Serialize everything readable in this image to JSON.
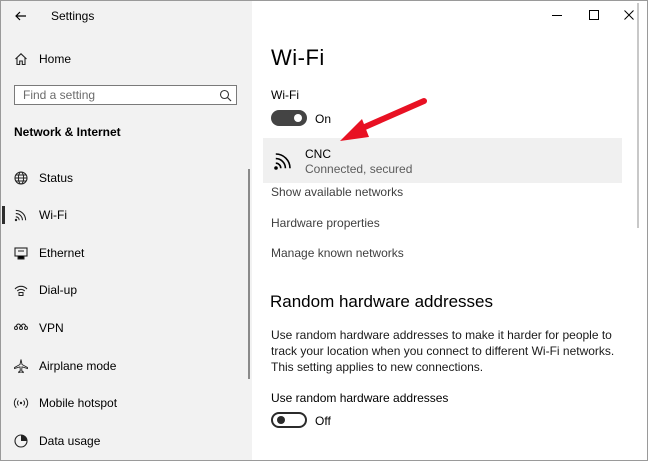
{
  "window": {
    "title": "Settings",
    "controls": [
      "minimize-icon",
      "maximize-icon",
      "close-icon"
    ]
  },
  "sidebar": {
    "home_label": "Home",
    "search_placeholder": "Find a setting",
    "section_title": "Network & Internet",
    "selected": "Wi-Fi",
    "items": [
      {
        "label": "Status",
        "icon": "globe-icon"
      },
      {
        "label": "Wi-Fi",
        "icon": "wifi-icon"
      },
      {
        "label": "Ethernet",
        "icon": "ethernet-icon"
      },
      {
        "label": "Dial-up",
        "icon": "dialup-icon"
      },
      {
        "label": "VPN",
        "icon": "vpn-icon"
      },
      {
        "label": "Airplane mode",
        "icon": "airplane-icon"
      },
      {
        "label": "Mobile hotspot",
        "icon": "hotspot-icon"
      },
      {
        "label": "Data usage",
        "icon": "data-usage-icon"
      }
    ]
  },
  "main": {
    "title": "Wi-Fi",
    "wifi_toggle": {
      "label": "Wi-Fi",
      "state": "On"
    },
    "network": {
      "name": "CNC",
      "status": "Connected, secured"
    },
    "links": [
      "Show available networks",
      "Hardware properties",
      "Manage known networks"
    ],
    "random_hw": {
      "heading": "Random hardware addresses",
      "description": "Use random hardware addresses to make it harder for people to track your location when you connect to different Wi-Fi networks. This setting applies to new connections.",
      "toggle_label": "Use random hardware addresses",
      "state": "Off"
    }
  },
  "colors": {
    "sidebar_bg": "#f2f2f2",
    "toggle_on": "#444444",
    "annotation_arrow": "#e81123"
  }
}
